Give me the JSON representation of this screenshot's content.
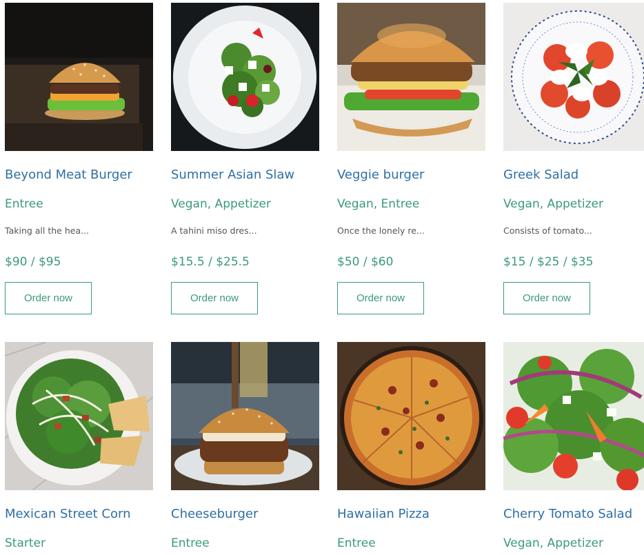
{
  "colors": {
    "title": "#2d6fa6",
    "accent": "#3a9a78",
    "text": "#555555"
  },
  "products": [
    {
      "name": "Beyond Meat Burger",
      "category": "Entree",
      "description": "Taking all the hea...",
      "price": "$90 / $95",
      "button": "Order now",
      "image_icon": "burger-icon"
    },
    {
      "name": "Summer Asian Slaw",
      "category": "Vegan, Appetizer",
      "description": "A tahini miso dres...",
      "price": "$15.5 / $25.5",
      "button": "Order now",
      "image_icon": "salad-icon"
    },
    {
      "name": "Veggie burger",
      "category": "Vegan, Entree",
      "description": "Once the lonely re...",
      "price": "$50 / $60",
      "button": "Order now",
      "image_icon": "burger-icon"
    },
    {
      "name": "Greek Salad",
      "category": "Vegan, Appetizer",
      "description": "Consists of tomato...",
      "price": "$15 / $25 / $35",
      "button": "Order now",
      "image_icon": "salad-icon"
    },
    {
      "name": "Mexican Street Corn",
      "category": "Starter",
      "image_icon": "salad-icon"
    },
    {
      "name": "Cheeseburger",
      "category": "Entree",
      "image_icon": "burger-icon"
    },
    {
      "name": "Hawaiian Pizza",
      "category": "Entree",
      "image_icon": "pizza-icon"
    },
    {
      "name": "Cherry Tomato Salad",
      "category": "Vegan, Appetizer",
      "image_icon": "salad-icon"
    }
  ]
}
